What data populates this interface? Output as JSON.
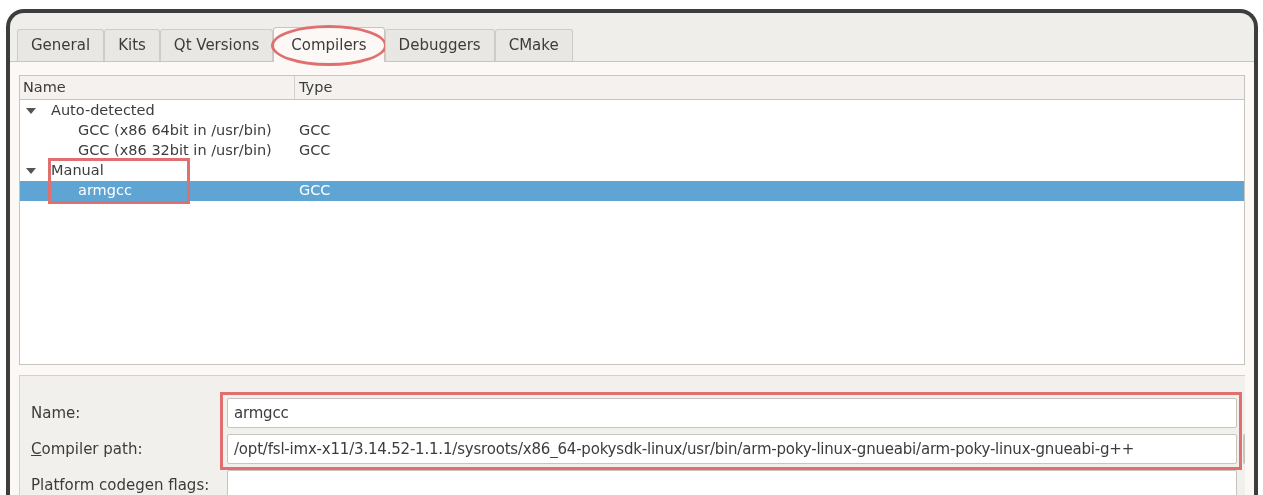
{
  "tabs": [
    {
      "label": "General",
      "selected": false,
      "highlighted": false
    },
    {
      "label": "Kits",
      "selected": false,
      "highlighted": false
    },
    {
      "label": "Qt Versions",
      "selected": false,
      "highlighted": false
    },
    {
      "label": "Compilers",
      "selected": true,
      "highlighted": true
    },
    {
      "label": "Debuggers",
      "selected": false,
      "highlighted": false
    },
    {
      "label": "CMake",
      "selected": false,
      "highlighted": false
    }
  ],
  "tree": {
    "columns": [
      "Name",
      "Type"
    ],
    "items": [
      {
        "name": "Auto-detected",
        "expanded": true,
        "selected": false,
        "highlighted": false,
        "children": [
          {
            "name": "GCC (x86 64bit in /usr/bin)",
            "type": "GCC",
            "selected": false,
            "highlighted": false
          },
          {
            "name": "GCC (x86 32bit in /usr/bin)",
            "type": "GCC",
            "selected": false,
            "highlighted": false
          }
        ]
      },
      {
        "name": "Manual",
        "expanded": true,
        "selected": false,
        "highlighted": true,
        "children": [
          {
            "name": "armgcc",
            "type": "GCC",
            "selected": true,
            "highlighted": true
          }
        ]
      }
    ]
  },
  "form": {
    "highlighted": true,
    "fields": [
      {
        "label": "Name:",
        "value": "armgcc",
        "mnemonic_underlined": false,
        "has_button": false
      },
      {
        "label": "Compiler path:",
        "value": "/opt/fsl-imx-x11/3.14.52-1.1.1/sysroots/x86_64-pokysdk-linux/usr/bin/arm-poky-linux-gnueabi/arm-poky-linux-gnueabi-g++",
        "mnemonic_underlined": true,
        "has_button": true
      },
      {
        "label": "Platform codegen flags:",
        "mnemonic_underlined": false,
        "has_button": false
      }
    ]
  }
}
